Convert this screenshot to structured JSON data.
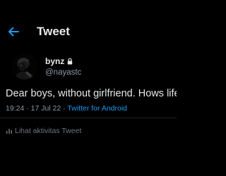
{
  "header": {
    "title": "Tweet",
    "back_icon": "arrow-left-icon"
  },
  "author": {
    "display_name": "bynz",
    "handle": "@nayastc",
    "lock_icon": "lock-icon"
  },
  "tweet": {
    "text": "Dear boys, without girlfriend. Hows life?",
    "time": "19:24",
    "separator": "·",
    "date": "17 Jul 22",
    "source": "Twitter for Android"
  },
  "activity": {
    "label": "Lihat aktivitas Tweet",
    "icon": "bar-chart-icon"
  },
  "colors": {
    "background": "#000000",
    "text": "#e7e9ea",
    "muted": "#8b98a5",
    "accent": "#1d9bf0"
  }
}
